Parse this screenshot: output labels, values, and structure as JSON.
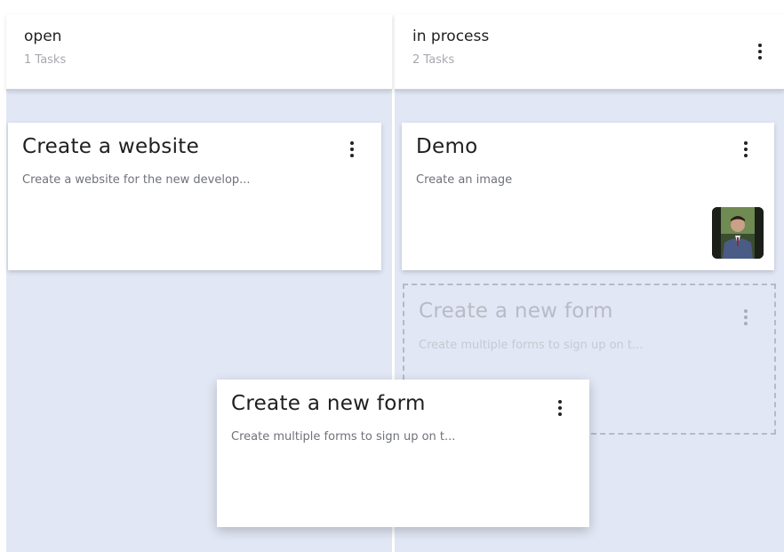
{
  "columns": [
    {
      "title": "open",
      "count": "1 Tasks"
    },
    {
      "title": "in process",
      "count": "2 Tasks"
    }
  ],
  "cards": {
    "website": {
      "title": "Create a website",
      "description": "Create a website for the new develop..."
    },
    "demo": {
      "title": "Demo",
      "description": "Create an image",
      "avatar_icon": "person-photo-icon"
    },
    "placeholder": {
      "title": "Create a new form",
      "description": "Create multiple forms to sign up on t..."
    },
    "dragging": {
      "title": "Create a new form",
      "description": "Create multiple forms to sign up on t..."
    }
  },
  "colors": {
    "lane_background": "#e2e7f5",
    "card_background": "#ffffff",
    "placeholder_border": "#b6bac4"
  }
}
